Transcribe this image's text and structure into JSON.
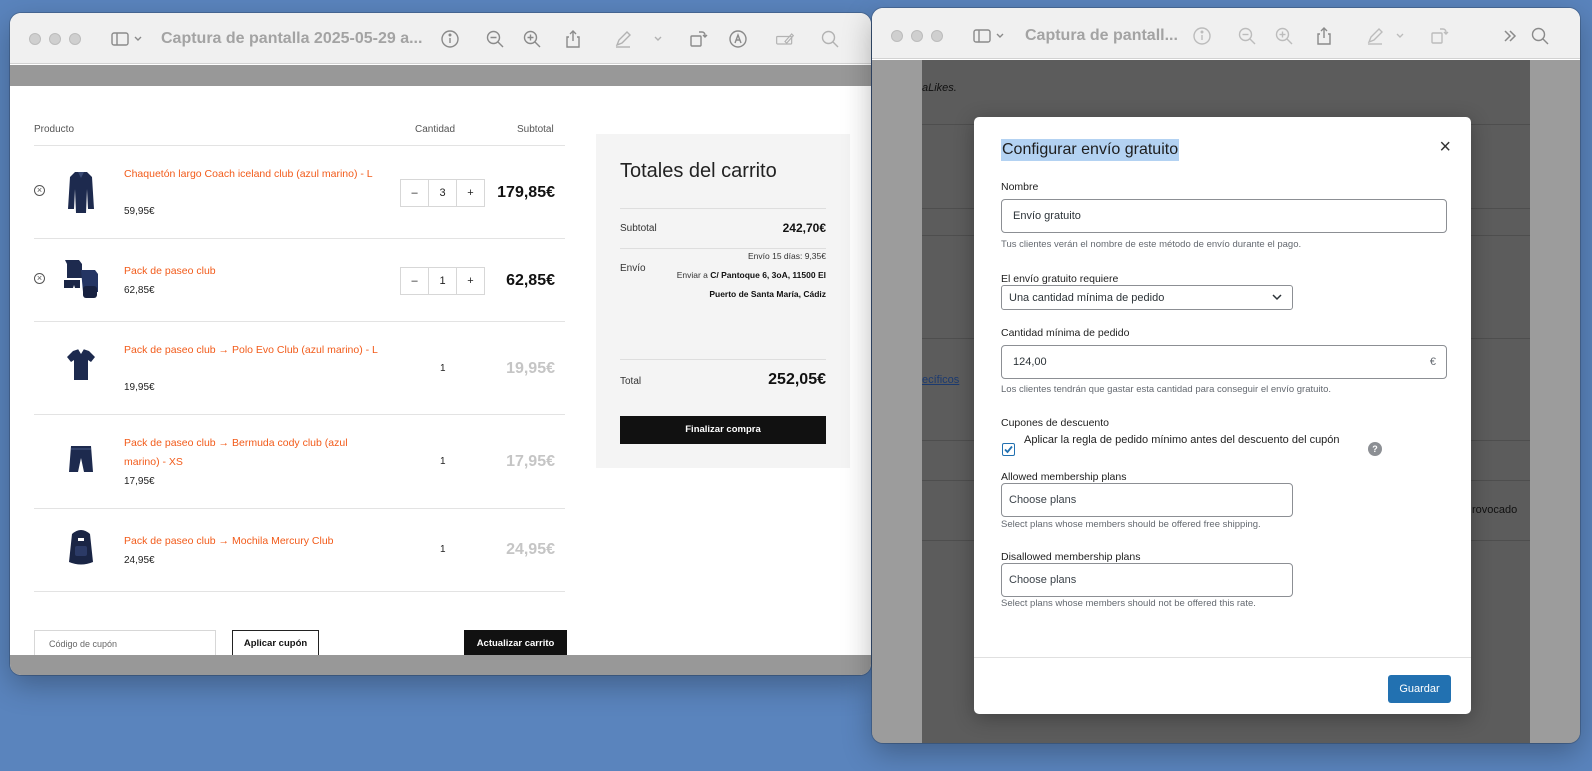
{
  "window1": {
    "title": "Captura de pantalla 2025-05-29 a...",
    "cart": {
      "headers": {
        "product": "Producto",
        "quantity": "Cantidad",
        "subtotal": "Subtotal"
      },
      "items": [
        {
          "name": "Chaquetón largo Coach iceland club (azul marino) - L",
          "price": "59,95€",
          "qty": "3",
          "subtotal": "179,85€",
          "editable": true
        },
        {
          "name": "Pack de paseo club",
          "price": "62,85€",
          "qty": "1",
          "subtotal": "62,85€",
          "editable": true
        },
        {
          "name": "Pack de paseo club → Polo Evo Club (azul marino) - L",
          "price": "19,95€",
          "qty": "1",
          "subtotal": "19,95€",
          "editable": false
        },
        {
          "name": "Pack de paseo club → Bermuda cody club (azul marino) - XS",
          "price": "17,95€",
          "qty": "1",
          "subtotal": "17,95€",
          "editable": false
        },
        {
          "name": "Pack de paseo club → Mochila Mercury Club",
          "price": "24,95€",
          "qty": "1",
          "subtotal": "24,95€",
          "editable": false
        }
      ],
      "stepper_minus": "–",
      "stepper_plus": "+",
      "remove_symbol": "×",
      "coupon_placeholder": "Código de cupón",
      "apply_coupon": "Aplicar cupón",
      "update_cart": "Actualizar carrito"
    },
    "totals": {
      "title": "Totales del carrito",
      "subtotal_label": "Subtotal",
      "subtotal_value": "242,70€",
      "shipping_label": "Envío",
      "shipping_method": "Envío 15 días: 9,35€",
      "ship_to_prefix": "Enviar a",
      "ship_to_address": "C/ Pantoque 6, 3oA, 11500 El Puerto de Santa María, Cádiz",
      "total_label": "Total",
      "total_value": "252,05€",
      "checkout_button": "Finalizar compra"
    }
  },
  "window2": {
    "title": "Captura de pantall...",
    "background_fragments": {
      "likes": "aLikes.",
      "specific": "ecíficos",
      "revoked": "rovocado"
    },
    "modal": {
      "title": "Configurar envío gratuito",
      "close": "×",
      "name_label": "Nombre",
      "name_value": "Envío gratuito",
      "name_help": "Tus clientes verán el nombre de este método de envío durante el pago.",
      "requires_label": "El envío gratuito requiere",
      "requires_value": "Una cantidad mínima de pedido",
      "min_amount_label": "Cantidad mínima de pedido",
      "min_amount_value": "124,00",
      "currency": "€",
      "min_amount_help": "Los clientes tendrán que gastar esta cantidad para conseguir el envío gratuito.",
      "coupons_label": "Cupones de descuento",
      "coupons_checkbox_label": "Aplicar la regla de pedido mínimo antes del descuento del cupón",
      "coupons_checked": true,
      "help_symbol": "?",
      "allowed_label": "Allowed membership plans",
      "allowed_placeholder": "Choose plans",
      "allowed_help": "Select plans whose members should be offered free shipping.",
      "disallowed_label": "Disallowed membership plans",
      "disallowed_placeholder": "Choose plans",
      "disallowed_help": "Select plans whose members should not be offered this rate.",
      "save_button": "Guardar"
    }
  }
}
